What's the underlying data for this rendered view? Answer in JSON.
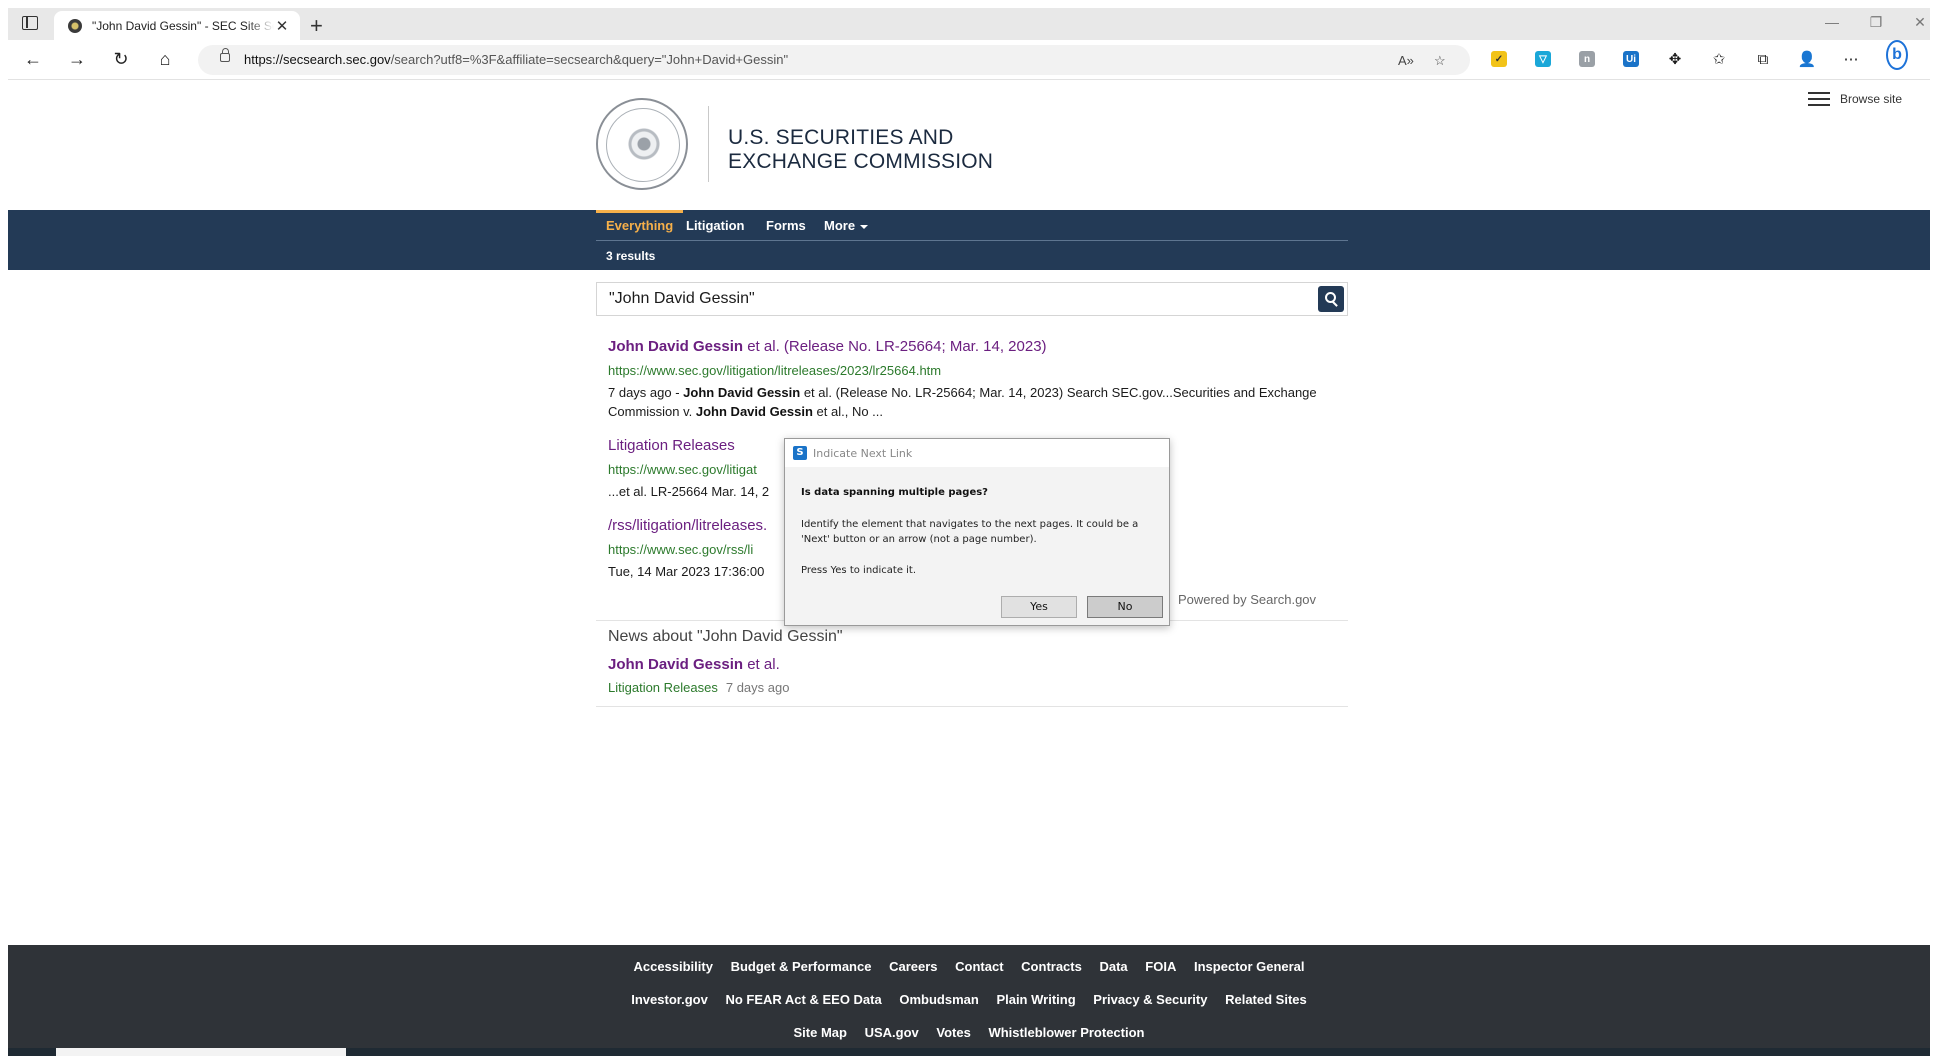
{
  "browser": {
    "tab_title": "\"John David Gessin\" - SEC Site Search",
    "url_host": "https://secsearch.sec.gov",
    "url_path": "/search?utf8=%3F&affiliate=secsearch&query=\"John+David+Gessin\""
  },
  "header": {
    "agency_line1": "U.S. SECURITIES AND",
    "agency_line2": "EXCHANGE COMMISSION",
    "browse_label": "Browse site"
  },
  "nav": {
    "tabs": [
      "Everything",
      "Litigation",
      "Forms",
      "More"
    ],
    "results_count": "3 results"
  },
  "search": {
    "query": "\"John David Gessin\""
  },
  "results": [
    {
      "title_bold": "John David Gessin",
      "title_rest": " et al. (Release No. LR-25664; Mar. 14, 2023)",
      "url": "https://www.sec.gov/litigation/litreleases/2023/lr25664.htm",
      "snippet_a": "7 days ago - ",
      "snippet_b": "John David Gessin",
      "snippet_c": " et al. (Release No. LR-25664; Mar. 14, 2023) Search SEC.gov...Securities and Exchange Commission v. ",
      "snippet_d": "John David Gessin",
      "snippet_e": " et al., No ..."
    },
    {
      "title": "Litigation Releases",
      "url": "https://www.sec.gov/litigat",
      "snippet": "...et al. LR-25664 Mar. 14, 2"
    },
    {
      "title": "/rss/litigation/litreleases.",
      "url": "https://www.sec.gov/rss/li",
      "snippet": "Tue, 14 Mar 2023 17:36:00"
    }
  ],
  "powered_by": "Powered by Search.gov",
  "news": {
    "heading": "News about \"John David Gessin\"",
    "title_bold": "John David Gessin",
    "title_rest": " et al.",
    "source": "Litigation Releases",
    "age": "7 days ago"
  },
  "footer": {
    "row1": [
      "Accessibility",
      "Budget & Performance",
      "Careers",
      "Contact",
      "Contracts",
      "Data",
      "FOIA",
      "Inspector General"
    ],
    "row2": [
      "Investor.gov",
      "No FEAR Act & EEO Data",
      "Ombudsman",
      "Plain Writing",
      "Privacy & Security",
      "Related Sites"
    ],
    "row3": [
      "Site Map",
      "USA.gov",
      "Votes",
      "Whistleblower Protection"
    ]
  },
  "dialog": {
    "title": "Indicate Next Link",
    "question": "Is data spanning multiple pages?",
    "body": "Identify the element that navigates to the next pages. It could be a 'Next' button or an arrow (not a page number).",
    "press": "Press Yes to indicate it.",
    "yes": "Yes",
    "no": "No"
  },
  "colors": {
    "navy": "#233a56",
    "accent": "#f6b04a",
    "link_purple": "#6b1f80",
    "url_green": "#2c7a2c",
    "footer": "#2f3338"
  }
}
